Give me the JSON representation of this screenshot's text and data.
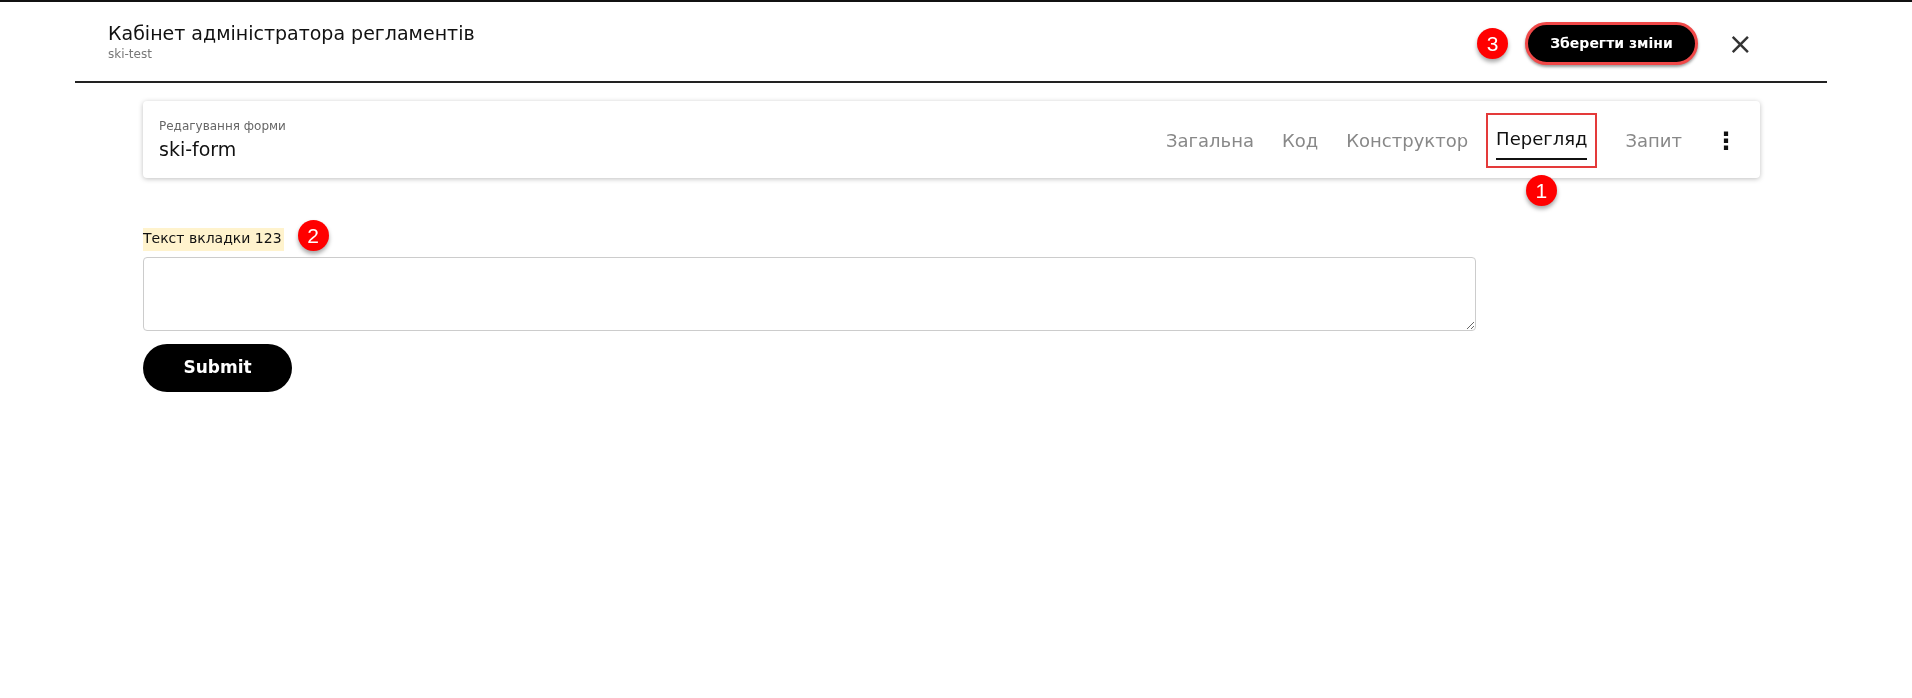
{
  "header": {
    "title": "Кабінет адміністратора регламентів",
    "subtitle": "ski-test",
    "save_button": {
      "label": "Зберегти зміни",
      "callout": "3"
    },
    "close": "×"
  },
  "form_bar": {
    "caption": "Редагування форми",
    "name": "ski-form",
    "tabs": [
      {
        "label": "Загальна",
        "selected": false
      },
      {
        "label": "Код",
        "selected": false
      },
      {
        "label": "Конструктор",
        "selected": false
      },
      {
        "label": "Перегляд",
        "selected": true,
        "callout": "1"
      },
      {
        "label": "Запит",
        "selected": false
      }
    ],
    "menu": "⋮"
  },
  "preview": {
    "field": {
      "label": "Текст вкладки 123",
      "callout": "2"
    },
    "submit": "Submit"
  }
}
